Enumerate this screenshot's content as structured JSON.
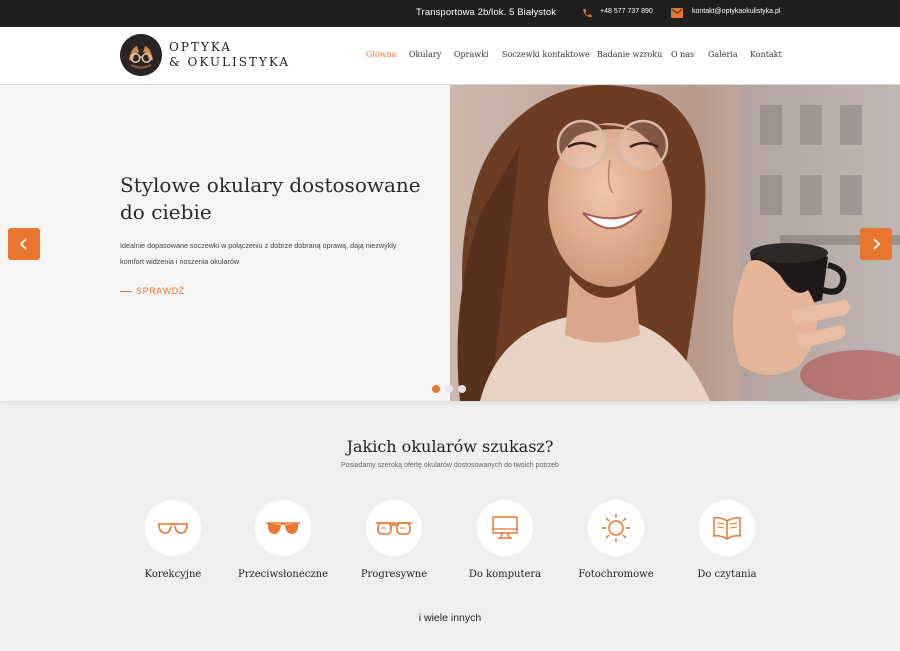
{
  "topbar": {
    "address": "Transportowa 2b/lok. 5 Białystok",
    "phone": "+48 577 737 890",
    "email": "kontakt@optykaokulistyka.pl",
    "phone_icon": "phone-icon",
    "mail_icon": "mail-icon"
  },
  "logo": {
    "line1": "OPTYKA",
    "line2": "& OKULISTYKA"
  },
  "nav": [
    {
      "label": "Główna",
      "active": true
    },
    {
      "label": "Okulary"
    },
    {
      "label": "Oprawki"
    },
    {
      "label": "Soczewki kontaktowe"
    },
    {
      "label": "Badanie wzroku"
    },
    {
      "label": "O nas"
    },
    {
      "label": "Galeria"
    },
    {
      "label": "Kontakt"
    }
  ],
  "hero": {
    "title": "Stylowe okulary dostosowane do ciebie",
    "description": "Idealnie dopasowane soczewki w połączeniu z dobrze dobraną oprawą, dają niezwykły komfort widzenia i noszenia okularów",
    "cta": "SPRAWDŹ",
    "slides_count": 3,
    "active_slide": 1
  },
  "categories_section": {
    "title": "Jakich okularów szukasz?",
    "subtitle": "Posiadamy szeroką ofertę okularów dostosowanych do twoich potrzeb",
    "items": [
      {
        "label": "Korekcyjne",
        "icon": "glasses-icon"
      },
      {
        "label": "Przeciwsłoneczne",
        "icon": "sunglasses-icon"
      },
      {
        "label": "Progresywne",
        "icon": "progressive-glasses-icon"
      },
      {
        "label": "Do komputera",
        "icon": "monitor-icon"
      },
      {
        "label": "Fotochromowe",
        "icon": "sun-icon"
      },
      {
        "label": "Do czytania",
        "icon": "book-icon"
      }
    ],
    "more": "i wiele innych"
  },
  "colors": {
    "accent": "#e8762e",
    "topbar": "#1f1f1f",
    "background": "#efefef"
  }
}
